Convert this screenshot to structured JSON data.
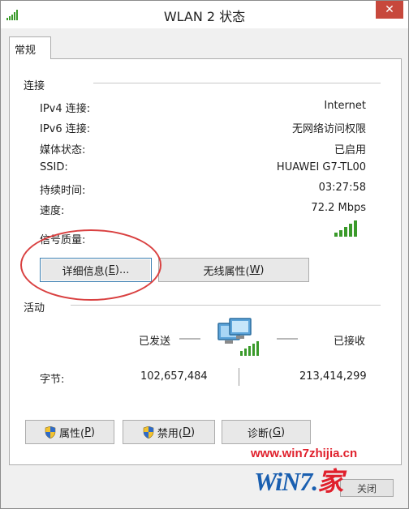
{
  "window": {
    "title": "WLAN 2 状态",
    "close_glyph": "✕",
    "title_icon": "signal-strength-icon"
  },
  "tabs": [
    {
      "label": "常规",
      "selected": true
    }
  ],
  "connection": {
    "group_label": "连接",
    "rows": [
      {
        "label": "IPv4 连接:",
        "value": "Internet"
      },
      {
        "label": "IPv6 连接:",
        "value": "无网络访问权限"
      },
      {
        "label": "媒体状态:",
        "value": "已启用"
      },
      {
        "label": "SSID:",
        "value": "HUAWEI G7-TL00"
      },
      {
        "label": "持续时间:",
        "value": "03:27:58"
      },
      {
        "label": "速度:",
        "value": "72.2 Mbps"
      }
    ],
    "signal_label": "信号质量:",
    "signal_bars": 5,
    "details_button": {
      "label": "详细信息(",
      "key": "E",
      "suffix": ")..."
    },
    "wireless_button": {
      "label": "无线属性(",
      "key": "W",
      "suffix": ")"
    }
  },
  "activity": {
    "group_label": "活动",
    "sent_label": "已发送",
    "received_label": "已接收",
    "bytes_label": "字节:",
    "bytes_sent": "102,657,484",
    "bytes_received": "213,414,299"
  },
  "bottom_buttons": {
    "properties": {
      "label": "属性(",
      "key": "P",
      "suffix": ")",
      "icon": "shield-icon"
    },
    "disable": {
      "label": "禁用(",
      "key": "D",
      "suffix": ")",
      "icon": "shield-icon"
    },
    "diagnose": {
      "label": "诊断(",
      "key": "G",
      "suffix": ")"
    }
  },
  "watermark": {
    "url": "www.win7zhijia.cn",
    "logo_text": "WiN7.",
    "logo_char": "家",
    "box_label": "关闭"
  },
  "colors": {
    "annotation": "#d94040",
    "signal_green": "#3a9a2a",
    "close_red": "#c7483c",
    "watermark_red": "#e0202c",
    "watermark_blue": "#1a5fb0"
  }
}
